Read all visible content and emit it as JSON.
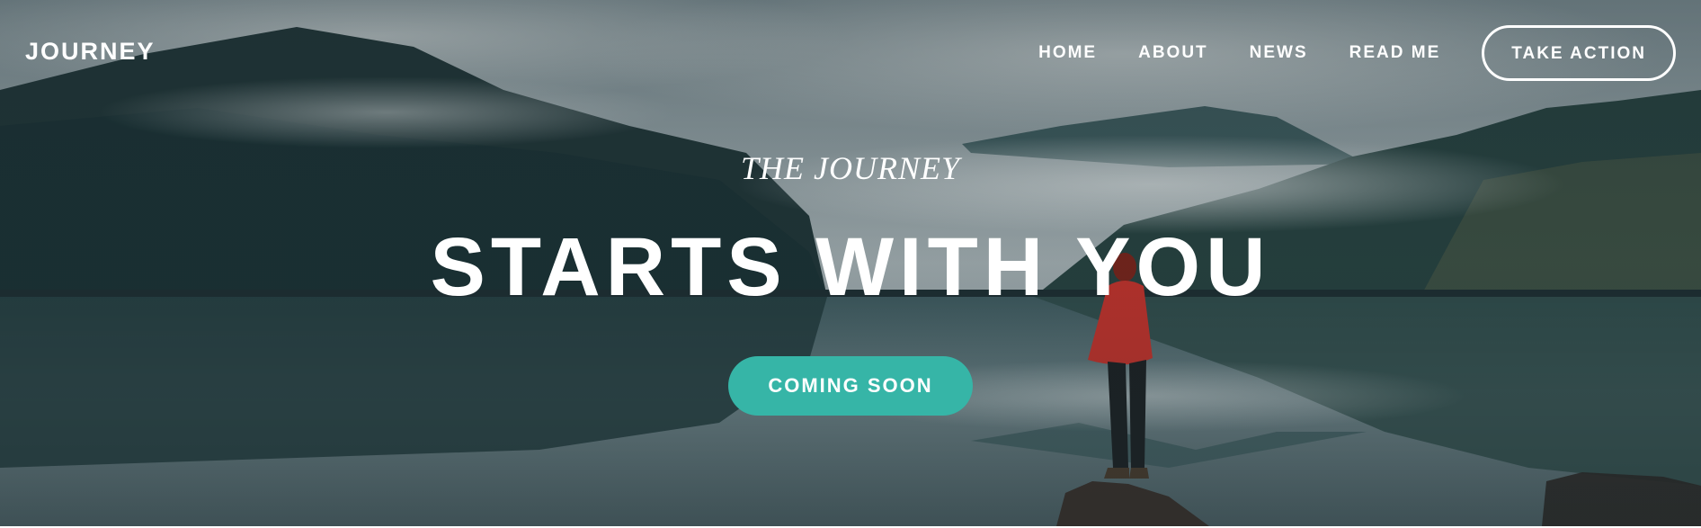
{
  "header": {
    "brand": "JOURNEY",
    "nav": [
      {
        "label": "HOME"
      },
      {
        "label": "ABOUT"
      },
      {
        "label": "NEWS"
      },
      {
        "label": "READ ME"
      }
    ],
    "cta_label": "TAKE ACTION"
  },
  "hero": {
    "kicker": "THE JOURNEY",
    "headline": "STARTS WITH YOU",
    "button_label": "COMING SOON",
    "button_color": "#36b5a7",
    "background": "misty-lake-mountains-photo"
  }
}
